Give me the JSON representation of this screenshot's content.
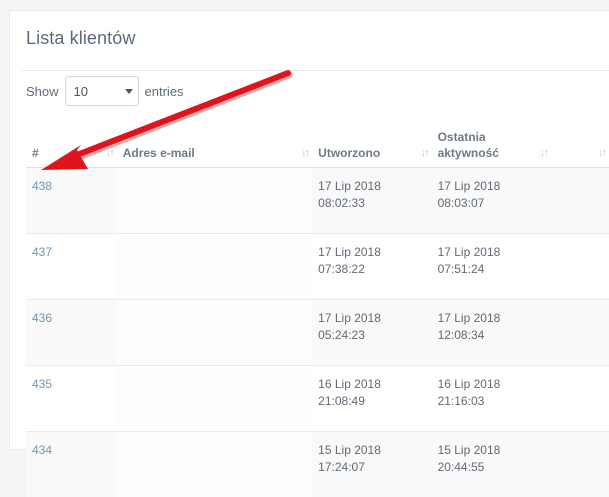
{
  "panel": {
    "title": "Lista klientów"
  },
  "length": {
    "show_label": "Show",
    "value": "10",
    "entries_label": "entries"
  },
  "table": {
    "headers": {
      "id": "#",
      "email": "Adres e-mail",
      "created": "Utworzono",
      "last_line1": "Ostatnia",
      "last_line2": "aktywność"
    },
    "rows": [
      {
        "id": "438",
        "email": "",
        "created_date": "17 Lip 2018",
        "created_time": "08:02:33",
        "last_date": "17 Lip 2018",
        "last_time": "08:03:07"
      },
      {
        "id": "437",
        "email": "",
        "created_date": "17 Lip 2018",
        "created_time": "07:38:22",
        "last_date": "17 Lip 2018",
        "last_time": "07:51:24"
      },
      {
        "id": "436",
        "email": "",
        "created_date": "17 Lip 2018",
        "created_time": "05:24:23",
        "last_date": "17 Lip 2018",
        "last_time": "12:08:34"
      },
      {
        "id": "435",
        "email": "",
        "created_date": "16 Lip 2018",
        "created_time": "21:08:49",
        "last_date": "16 Lip 2018",
        "last_time": "21:16:03"
      },
      {
        "id": "434",
        "email": "",
        "created_date": "15 Lip 2018",
        "created_time": "17:24:07",
        "last_date": "15 Lip 2018",
        "last_time": "20:44:55"
      }
    ]
  },
  "colors": {
    "arrow": "#e0141b",
    "link": "#6f97b4"
  }
}
